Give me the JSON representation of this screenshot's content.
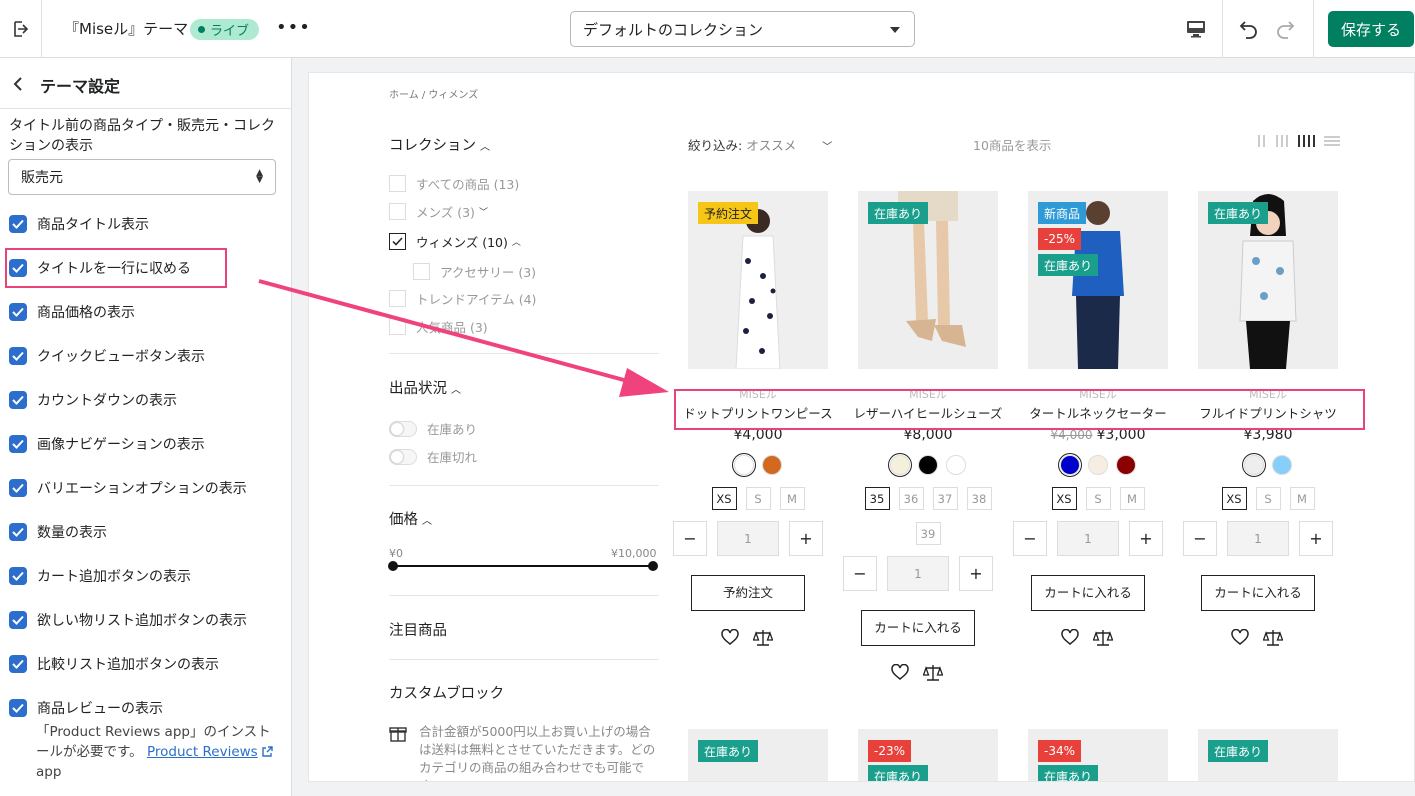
{
  "topbar": {
    "theme_name": "『Miseル』テーマ",
    "live_badge": "ライブ",
    "more": "•••",
    "collection_select": "デフォルトのコレクション",
    "save": "保存する"
  },
  "sidebar": {
    "title": "テーマ設定",
    "field_label": "タイトル前の商品タイプ・販売元・コレクションの表示",
    "field_value": "販売元",
    "checkboxes": [
      {
        "label": "商品タイトル表示"
      },
      {
        "label": "タイトルを一行に収める"
      },
      {
        "label": "商品価格の表示"
      },
      {
        "label": "クイックビューボタン表示"
      },
      {
        "label": "カウントダウンの表示"
      },
      {
        "label": "画像ナビゲーションの表示"
      },
      {
        "label": "バリエーションオプションの表示"
      },
      {
        "label": "数量の表示"
      },
      {
        "label": "カート追加ボタンの表示"
      },
      {
        "label": "欲しい物リスト追加ボタンの表示"
      },
      {
        "label": "比較リスト追加ボタンの表示"
      },
      {
        "label": "商品レビューの表示"
      }
    ],
    "review_note_pre": "「Product Reviews app」のインストールが必要です。",
    "review_link": "Product Reviews",
    "review_note_post": "app"
  },
  "preview": {
    "breadcrumb": "ホーム  /  ウィメンズ",
    "filters": {
      "collection_title": "コレクション",
      "collection_items": [
        {
          "label": "すべての商品 (13)",
          "checked": false
        },
        {
          "label": "メンズ (3)",
          "checked": false
        },
        {
          "label": "ウィメンズ (10)",
          "checked": true
        },
        {
          "label": "アクセサリー (3)",
          "checked": false
        },
        {
          "label": "トレンドアイテム (4)",
          "checked": false
        },
        {
          "label": "人気商品 (3)",
          "checked": false
        }
      ],
      "stock_title": "出品状況",
      "stock_items": [
        "在庫あり",
        "在庫切れ"
      ],
      "price_title": "価格",
      "price_min": "¥0",
      "price_max": "¥10,000",
      "featured_title": "注目商品",
      "custom_title": "カスタムブロック",
      "custom_text": "合計金額が5000円以上お買い上げの場合は送料は無料とさせていただきます。どのカテゴリの商品の組み合わせでも可能です。"
    },
    "sort_label": "絞り込み:",
    "sort_value": "オススメ",
    "count_label": "10商品を表示",
    "products": [
      {
        "badges": [
          {
            "text": "予約注文",
            "color": "#f5c518",
            "text_color": "#222"
          }
        ],
        "vendor": "MISEル",
        "title": "ドットプリントワンピース",
        "old_price": "",
        "price": "¥4,000",
        "swatches": [
          "#ffffff",
          "#d2691e"
        ],
        "sizes": [
          "XS",
          "S",
          "M"
        ],
        "qty": "1",
        "button": "予約注文"
      },
      {
        "badges": [
          {
            "text": "在庫あり",
            "color": "#1a9f8c",
            "text_color": "#fff"
          }
        ],
        "vendor": "MISEル",
        "title": "レザーハイヒールシューズ",
        "old_price": "",
        "price": "¥8,000",
        "swatches": [
          "#f5f0dc",
          "#000000",
          "#ffffff"
        ],
        "sizes": [
          "35",
          "36",
          "37",
          "38",
          "39"
        ],
        "qty": "1",
        "button": "カートに入れる"
      },
      {
        "badges": [
          {
            "text": "新商品",
            "color": "#2f9bd6",
            "text_color": "#fff"
          },
          {
            "text": "-25%",
            "color": "#e8413c",
            "text_color": "#fff"
          },
          {
            "text": "在庫あり",
            "color": "#1a9f8c",
            "text_color": "#fff"
          }
        ],
        "vendor": "MISEル",
        "title": "タートルネックセーター",
        "old_price": "¥4,000",
        "price": "¥3,000",
        "swatches": [
          "#0000cc",
          "#f8ede3",
          "#8b0000"
        ],
        "sizes": [
          "XS",
          "S",
          "M"
        ],
        "qty": "1",
        "button": "カートに入れる"
      },
      {
        "badges": [
          {
            "text": "在庫あり",
            "color": "#1a9f8c",
            "text_color": "#fff"
          }
        ],
        "vendor": "MISEル",
        "title": "フルイドプリントシャツ",
        "old_price": "",
        "price": "¥3,980",
        "swatches": [
          "#eeeeee",
          "#87cefa"
        ],
        "sizes": [
          "XS",
          "S",
          "M"
        ],
        "qty": "1",
        "button": "カートに入れる"
      }
    ],
    "row2_badges": [
      [
        {
          "text": "在庫あり",
          "color": "#1a9f8c"
        }
      ],
      [
        {
          "text": "-23%",
          "color": "#e8413c"
        },
        {
          "text": "在庫あり",
          "color": "#1a9f8c"
        }
      ],
      [
        {
          "text": "-34%",
          "color": "#e8413c"
        },
        {
          "text": "在庫あり",
          "color": "#1a9f8c"
        }
      ],
      [
        {
          "text": "在庫あり",
          "color": "#1a9f8c"
        }
      ]
    ]
  },
  "colors": {
    "accent": "#2c6ecb",
    "save": "#008060",
    "highlight": "#e8447a"
  }
}
